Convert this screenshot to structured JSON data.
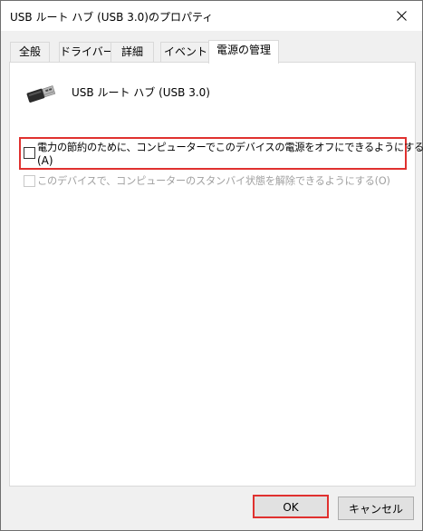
{
  "window": {
    "title": "USB ルート ハブ (USB 3.0)のプロパティ"
  },
  "tabs": [
    {
      "label": "全般"
    },
    {
      "label": "ドライバー"
    },
    {
      "label": "詳細"
    },
    {
      "label": "イベント"
    },
    {
      "label": "電源の管理"
    }
  ],
  "active_tab": "電源の管理",
  "device": {
    "name": "USB ルート ハブ (USB 3.0)",
    "icon": "usb-plug-icon"
  },
  "options": [
    {
      "label_line1": "電力の節約のために、コンピューターでこのデバイスの電源をオフにできるようにする",
      "label_line2": "(A)",
      "checked": false,
      "enabled": true
    },
    {
      "label": "このデバイスで、コンピューターのスタンバイ状態を解除できるようにする(O)",
      "checked": false,
      "enabled": false
    }
  ],
  "buttons": {
    "ok": "OK",
    "cancel": "キャンセル"
  },
  "colors": {
    "highlight": "#e0312f",
    "dialog_bg": "#f0f0f0",
    "disabled_text": "#a0a0a0"
  }
}
